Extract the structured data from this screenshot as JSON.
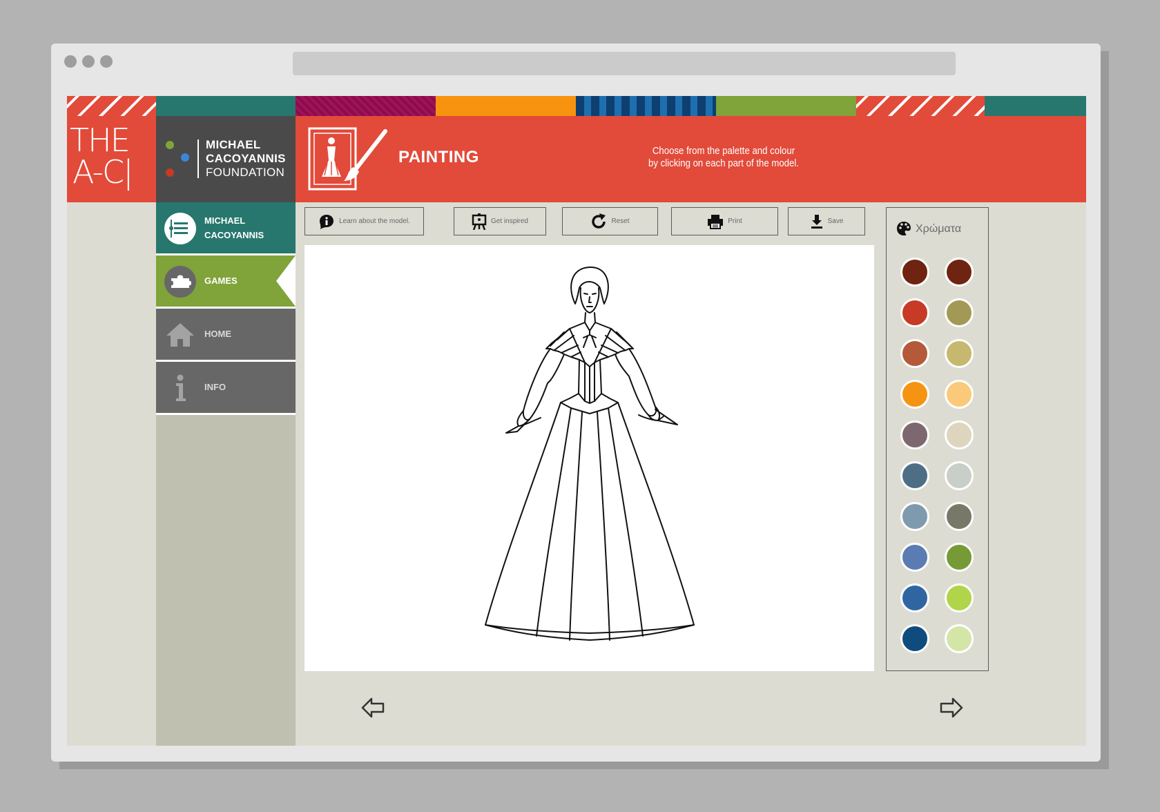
{
  "logo": {
    "line1": "THE",
    "line2": "A-C|"
  },
  "foundation": {
    "line1": "MICHAEL",
    "line2": "CACOYANNIS",
    "line3": "FOUNDATION"
  },
  "header": {
    "title": "PAINTING",
    "instructions_line1": "Choose from the palette and colour",
    "instructions_line2": "by clicking on each part of the model."
  },
  "sidebar": {
    "items": [
      {
        "label_line1": "MICHAEL",
        "label_line2": "CACOYANNIS",
        "icon": "list-icon",
        "color": "#27776e"
      },
      {
        "label_line1": "GAMES",
        "label_line2": "",
        "icon": "puzzle-icon",
        "color": "#80a33a",
        "active": true
      },
      {
        "label_line1": "HOME",
        "label_line2": "",
        "icon": "home-icon",
        "color": "#676767"
      },
      {
        "label_line1": "INFO",
        "label_line2": "",
        "icon": "info-icon",
        "color": "#676767"
      }
    ]
  },
  "toolbar": {
    "learn": "Learn about the model.",
    "inspire": "Get inspired",
    "reset": "Reset",
    "print": "Print",
    "save": "Save"
  },
  "palette": {
    "title": "Χρώματα",
    "colors": [
      [
        "#6e2410",
        "#6e2410"
      ],
      [
        "#c63a26",
        "#a39957"
      ],
      [
        "#b45a3a",
        "#c6b86e"
      ],
      [
        "#f59412",
        "#fbc97a"
      ],
      [
        "#7e6870",
        "#ddd5bd"
      ],
      [
        "#4e6e86",
        "#c8cfc9"
      ],
      [
        "#7f9aae",
        "#777867"
      ],
      [
        "#5a7cb2",
        "#769a35"
      ],
      [
        "#2f66a2",
        "#b0d44a"
      ],
      [
        "#0e4c7e",
        "#d4e5a8"
      ]
    ]
  }
}
